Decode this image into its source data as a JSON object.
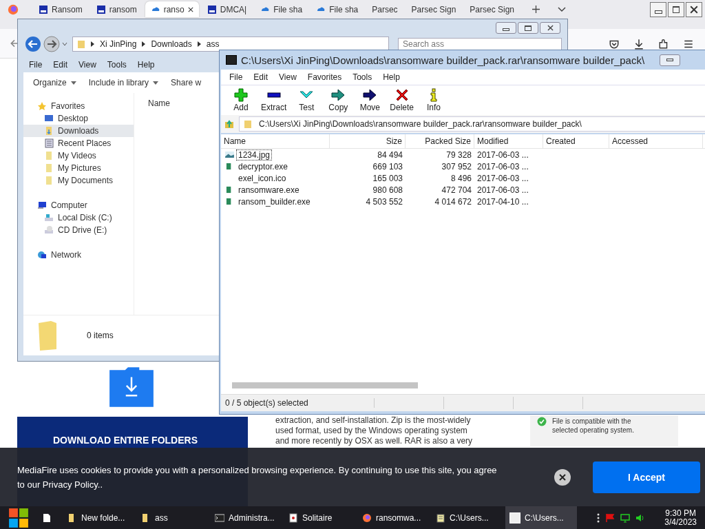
{
  "browser": {
    "tabs": [
      {
        "label": "Ransom",
        "kind": "mf",
        "selected": false
      },
      {
        "label": "ransom",
        "kind": "mf",
        "selected": false
      },
      {
        "label": "ranso",
        "kind": "cloud",
        "selected": true
      },
      {
        "label": "DMCA|",
        "kind": "mf",
        "selected": false
      },
      {
        "label": "File sha",
        "kind": "cloud",
        "selected": false
      },
      {
        "label": "File sha",
        "kind": "cloud",
        "selected": false
      },
      {
        "label": "Parsec",
        "kind": "plain",
        "selected": false
      },
      {
        "label": "Parsec Sign",
        "kind": "plain",
        "selected": false
      },
      {
        "label": "Parsec Sign",
        "kind": "plain",
        "selected": false
      }
    ]
  },
  "page": {
    "banner_title": "DOWNLOAD ENTIRE FOLDERS",
    "article_lines": [
      "extraction, and self-installation. Zip is the most-widely",
      "used format, used by the Windows operating system",
      "and more recently by OSX as well. RAR is also a very"
    ],
    "compat_lines": [
      "File is compatible with the",
      "selected operating system."
    ]
  },
  "cookie": {
    "text": "MediaFire uses cookies to provide you with a personalized browsing experience. By continuing to use this site, you agree to our Privacy Policy..",
    "accept": "I Accept"
  },
  "explorer": {
    "breadcrumb": [
      "Xi JinPing",
      "Downloads",
      "ass"
    ],
    "search": {
      "placeholder": "Search ass"
    },
    "menu": [
      "File",
      "Edit",
      "View",
      "Tools",
      "Help"
    ],
    "toolbar": [
      {
        "label": "Organize",
        "dropdown": true
      },
      {
        "label": "Include in library",
        "dropdown": true
      },
      {
        "label": "Share w",
        "dropdown": false
      }
    ],
    "nav": [
      {
        "label": "Favorites",
        "kind": "star",
        "selected": false,
        "children": [
          {
            "label": "Desktop",
            "kind": "desktop",
            "selected": false
          },
          {
            "label": "Downloads",
            "kind": "downloads",
            "selected": true
          },
          {
            "label": "Recent Places",
            "kind": "recent",
            "selected": false
          },
          {
            "label": "My Videos",
            "kind": "folder",
            "selected": false
          },
          {
            "label": "My Pictures",
            "kind": "folder",
            "selected": false
          },
          {
            "label": "My Documents",
            "kind": "folder",
            "selected": false
          }
        ]
      },
      {
        "label": "Computer",
        "kind": "computer",
        "selected": false,
        "children": [
          {
            "label": "Local Disk (C:)",
            "kind": "disk",
            "selected": false
          },
          {
            "label": "CD Drive (E:)",
            "kind": "cd",
            "selected": false
          }
        ]
      },
      {
        "label": "Network",
        "kind": "network",
        "selected": false
      }
    ],
    "column": "Name",
    "status": "0 items"
  },
  "archive": {
    "title": "C:\\Users\\Xi JinPing\\Downloads\\ransomware builder_pack.rar\\ransomware builder_pack\\",
    "menu": [
      "File",
      "Edit",
      "View",
      "Favorites",
      "Tools",
      "Help"
    ],
    "tools": [
      {
        "label": "Add",
        "kind": "add"
      },
      {
        "label": "Extract",
        "kind": "extract"
      },
      {
        "label": "Test",
        "kind": "test"
      },
      {
        "label": "Copy",
        "kind": "copy"
      },
      {
        "label": "Move",
        "kind": "move"
      },
      {
        "label": "Delete",
        "kind": "delete"
      },
      {
        "label": "Info",
        "kind": "info"
      }
    ],
    "path": "C:\\Users\\Xi JinPing\\Downloads\\ransomware builder_pack.rar\\ransomware builder_pack\\",
    "columns": [
      "Name",
      "Size",
      "Packed Size",
      "Modified",
      "Created",
      "Accessed"
    ],
    "rows": [
      {
        "name": "1234.jpg",
        "size": "84 494",
        "packed": "79 328",
        "modified": "2017-06-03 ...",
        "kind": "image",
        "focused": true
      },
      {
        "name": "decryptor.exe",
        "size": "669 103",
        "packed": "307 952",
        "modified": "2017-06-03 ...",
        "kind": "exe",
        "focused": false
      },
      {
        "name": "exel_icon.ico",
        "size": "165 003",
        "packed": "8 496",
        "modified": "2017-06-03 ...",
        "kind": "plain",
        "focused": false
      },
      {
        "name": "ransomware.exe",
        "size": "980 608",
        "packed": "472 704",
        "modified": "2017-06-03 ...",
        "kind": "exe",
        "focused": false
      },
      {
        "name": "ransom_builder.exe",
        "size": "4 503 552",
        "packed": "4 014 672",
        "modified": "2017-04-10 ...",
        "kind": "exe",
        "focused": false
      }
    ],
    "status": "0 / 5 object(s) selected"
  },
  "taskbar": {
    "items": [
      {
        "label": "New folde...",
        "kind": "folder",
        "selected": false
      },
      {
        "label": "ass",
        "kind": "folder",
        "selected": false
      },
      {
        "label": "Administra...",
        "kind": "console",
        "selected": false
      },
      {
        "label": "Solitaire",
        "kind": "cards",
        "selected": false
      },
      {
        "label": "ransomwa...",
        "kind": "firefox",
        "selected": false
      },
      {
        "label": "C:\\Users...",
        "kind": "notepad",
        "selected": false
      },
      {
        "label": "C:\\Users...",
        "kind": "sevenzip",
        "selected": true
      }
    ],
    "time": "9:30 PM",
    "date": "3/4/2023"
  }
}
